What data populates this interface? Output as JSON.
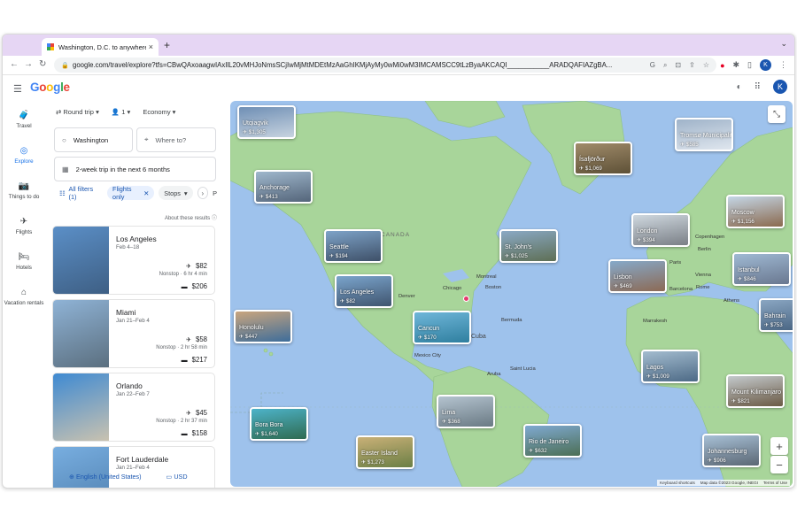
{
  "browser": {
    "tab_title": "Washington, D.C. to anywhere",
    "tab_close": "×",
    "new_tab": "+",
    "tab_menu": "⌄",
    "url": "google.com/travel/explore?tfs=CBwQAxoaagwIAxIlL20vMHJoNmsSCjIwMjMtMDEtMzAaGhIKMjAyMy0wMi0wM3IMCAMSCC9tLzByaAKCAQI___________ARADQAFIAZgBA...",
    "profile_initial": "K"
  },
  "header": {
    "logo_letters": [
      {
        "ch": "G",
        "color": "#4285f4"
      },
      {
        "ch": "o",
        "color": "#ea4335"
      },
      {
        "ch": "o",
        "color": "#fbbc05"
      },
      {
        "ch": "g",
        "color": "#4285f4"
      },
      {
        "ch": "l",
        "color": "#34a853"
      },
      {
        "ch": "e",
        "color": "#ea4335"
      }
    ],
    "avatar_initial": "K"
  },
  "rail": [
    {
      "label": "Travel",
      "icon": "suitcase-icon",
      "glyph": "🧳"
    },
    {
      "label": "Explore",
      "icon": "explore-icon",
      "glyph": "◎"
    },
    {
      "label": "Things to do",
      "icon": "camera-icon",
      "glyph": "📷"
    },
    {
      "label": "Flights",
      "icon": "plane-icon",
      "glyph": "✈"
    },
    {
      "label": "Hotels",
      "icon": "bed-icon",
      "glyph": "🛏"
    },
    {
      "label": "Vacation rentals",
      "icon": "house-icon",
      "glyph": "⌂"
    }
  ],
  "search": {
    "trip_type": "Round trip",
    "passengers": "1",
    "cabin": "Economy",
    "origin": "Washington",
    "destination_placeholder": "Where to?",
    "dates": "2-week trip in the next 6 months"
  },
  "chips": {
    "all_filters": "All filters (1)",
    "flights_only": "Flights only",
    "stops": "Stops",
    "overflow": "P"
  },
  "about_results": "About these results",
  "results": [
    {
      "name": "Los Angeles",
      "dates": "Feb 4–18",
      "flight_price": "$82",
      "duration": "Nonstop · 6 hr 4 min",
      "hotel_price": "$206",
      "colors": [
        "#5b8fc7",
        "#3e5f84"
      ]
    },
    {
      "name": "Miami",
      "dates": "Jan 21–Feb 4",
      "flight_price": "$58",
      "duration": "Nonstop · 2 hr 58 min",
      "hotel_price": "$217",
      "colors": [
        "#8fb3d6",
        "#5b6f7f"
      ]
    },
    {
      "name": "Orlando",
      "dates": "Jan 22–Feb 7",
      "flight_price": "$45",
      "duration": "Nonstop · 2 hr 37 min",
      "hotel_price": "$158",
      "colors": [
        "#3f8ad2",
        "#c9c2b0"
      ]
    },
    {
      "name": "Fort Lauderdale",
      "dates": "Jan 21–Feb 4",
      "flight_price": "",
      "duration": "",
      "hotel_price": "",
      "colors": [
        "#78aee0",
        "#4f7fae"
      ]
    }
  ],
  "footer": {
    "language": "English (United States)",
    "currency": "USD"
  },
  "map": {
    "land_color": "#a8d59a",
    "water_color": "#9ec2ec",
    "country_labels": [
      "CANADA"
    ],
    "place_labels": [
      "Denver",
      "Chicago",
      "Montreal",
      "Boston",
      "Bermuda",
      "Mexico City",
      "Aruba",
      "Saint Lucia",
      "Copenhagen",
      "Berlin",
      "Paris",
      "Vienna",
      "Barcelona",
      "Rome",
      "Athens",
      "Marrakesh"
    ],
    "partial_label": "Cuba",
    "pins": [
      {
        "name": "Utqiagvik",
        "price": "$1,305",
        "colors": [
          "#6f8fb5",
          "#c7d3df"
        ]
      },
      {
        "name": "Anchorage",
        "price": "$413",
        "colors": [
          "#9fb7cc",
          "#54657a"
        ]
      },
      {
        "name": "Seattle",
        "price": "$194",
        "colors": [
          "#7ea3c8",
          "#3e5068"
        ]
      },
      {
        "name": "Los Angeles",
        "price": "$82",
        "colors": [
          "#7aa4cc",
          "#40556f"
        ]
      },
      {
        "name": "Honolulu",
        "price": "$447",
        "colors": [
          "#c9a57e",
          "#3e6d9a"
        ]
      },
      {
        "name": "Cancun",
        "price": "$170",
        "colors": [
          "#6fb6d9",
          "#2f7f9f"
        ]
      },
      {
        "name": "St. John's",
        "price": "$1,025",
        "colors": [
          "#8aa9c5",
          "#5e6f55"
        ]
      },
      {
        "name": "Ísafjörður",
        "price": "$1,069",
        "colors": [
          "#a08b6a",
          "#5e5137"
        ]
      },
      {
        "name": "Tromsø Municipality",
        "price": "$585",
        "colors": [
          "#9fb3c9",
          "#dfe6ee"
        ]
      },
      {
        "name": "Moscow",
        "price": "$1,156",
        "colors": [
          "#c4d6e6",
          "#8b6a4f"
        ]
      },
      {
        "name": "London",
        "price": "$394",
        "colors": [
          "#cfd8df",
          "#7a7f86"
        ]
      },
      {
        "name": "Lisbon",
        "price": "$469",
        "colors": [
          "#86a9c9",
          "#8c6a55"
        ]
      },
      {
        "name": "Istanbul",
        "price": "$846",
        "colors": [
          "#9fb9d3",
          "#6a7890"
        ]
      },
      {
        "name": "Bahrain",
        "price": "$753",
        "colors": [
          "#8aa6c2",
          "#44607e"
        ]
      },
      {
        "name": "Lagos",
        "price": "$1,009",
        "colors": [
          "#a3bccf",
          "#4d6a86"
        ]
      },
      {
        "name": "Mount Kilimanjaro",
        "price": "$821",
        "colors": [
          "#c3c9cc",
          "#6b5a45"
        ]
      },
      {
        "name": "Johannesburg",
        "price": "$906",
        "colors": [
          "#a7c0d6",
          "#5b6774"
        ]
      },
      {
        "name": "Rio de Janeiro",
        "price": "$632",
        "colors": [
          "#7fa9d1",
          "#4c6f55"
        ]
      },
      {
        "name": "Lima",
        "price": "$368",
        "colors": [
          "#b4c3cf",
          "#6a7a84"
        ]
      },
      {
        "name": "Bora Bora",
        "price": "$1,640",
        "colors": [
          "#4db3c9",
          "#2f6b51"
        ]
      },
      {
        "name": "Easter Island",
        "price": "$1,273",
        "colors": [
          "#c9b077",
          "#6b7f45"
        ]
      }
    ],
    "zoom_in": "+",
    "zoom_out": "−",
    "attribution": [
      "Keyboard shortcuts",
      "Map data ©2023 Google, INEGI",
      "Terms of Use"
    ]
  }
}
